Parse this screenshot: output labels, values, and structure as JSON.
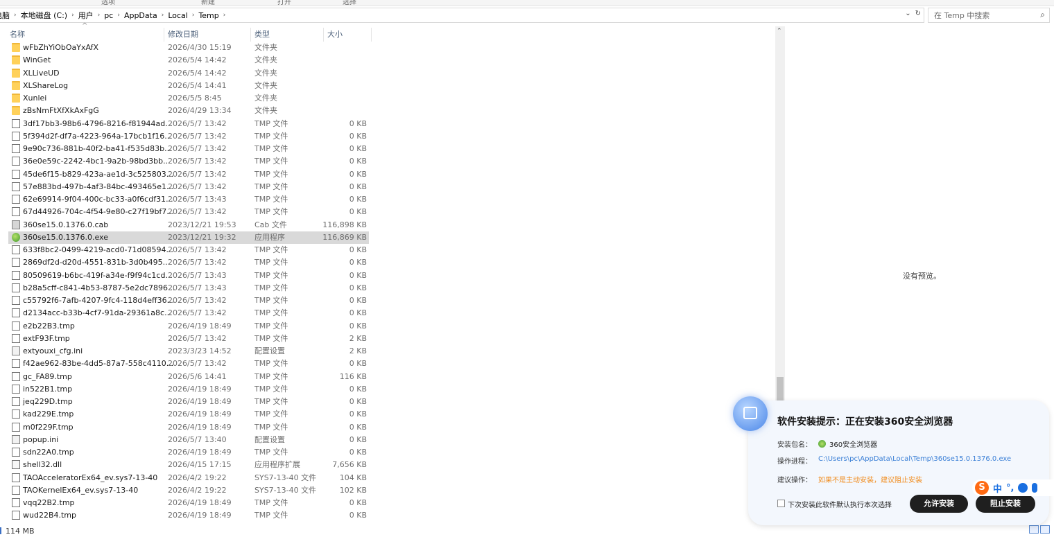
{
  "ribbon_partial": [
    "选项",
    "新建",
    "打开",
    "选择"
  ],
  "breadcrumb": [
    "电脑",
    "本地磁盘 (C:)",
    "用户",
    "pc",
    "AppData",
    "Local",
    "Temp"
  ],
  "search": {
    "placeholder": "在 Temp 中搜索"
  },
  "columns": {
    "name": "名称",
    "modified": "修改日期",
    "type": "类型",
    "size": "大小"
  },
  "files": [
    {
      "name": "wFbZhYiObOaYxAfX",
      "date": "2026/4/30 15:19",
      "type": "文件夹",
      "size": "",
      "icon": "folder"
    },
    {
      "name": "WinGet",
      "date": "2026/5/4 14:42",
      "type": "文件夹",
      "size": "",
      "icon": "folder"
    },
    {
      "name": "XLLiveUD",
      "date": "2026/5/4 14:42",
      "type": "文件夹",
      "size": "",
      "icon": "folder"
    },
    {
      "name": "XLShareLog",
      "date": "2026/5/4 14:41",
      "type": "文件夹",
      "size": "",
      "icon": "folder"
    },
    {
      "name": "Xunlei",
      "date": "2026/5/5 8:45",
      "type": "文件夹",
      "size": "",
      "icon": "folder"
    },
    {
      "name": "zBsNmFtXfXkAxFgG",
      "date": "2026/4/29 13:34",
      "type": "文件夹",
      "size": "",
      "icon": "folder"
    },
    {
      "name": "3df17bb3-98b6-4796-8216-f81944ad...",
      "date": "2026/5/7 13:42",
      "type": "TMP 文件",
      "size": "0 KB",
      "icon": "file"
    },
    {
      "name": "5f394d2f-df7a-4223-964a-17bcb1f16...",
      "date": "2026/5/7 13:42",
      "type": "TMP 文件",
      "size": "0 KB",
      "icon": "file"
    },
    {
      "name": "9e90c736-881b-40f2-ba41-f535d83b...",
      "date": "2026/5/7 13:42",
      "type": "TMP 文件",
      "size": "0 KB",
      "icon": "file"
    },
    {
      "name": "36e0e59c-2242-4bc1-9a2b-98bd3bb...",
      "date": "2026/5/7 13:42",
      "type": "TMP 文件",
      "size": "0 KB",
      "icon": "file"
    },
    {
      "name": "45de6f15-b829-423a-ae1d-3c525803...",
      "date": "2026/5/7 13:42",
      "type": "TMP 文件",
      "size": "0 KB",
      "icon": "file"
    },
    {
      "name": "57e883bd-497b-4af3-84bc-493465e1...",
      "date": "2026/5/7 13:42",
      "type": "TMP 文件",
      "size": "0 KB",
      "icon": "file"
    },
    {
      "name": "62e69914-9f04-400c-bc33-a0f6cdf31...",
      "date": "2026/5/7 13:43",
      "type": "TMP 文件",
      "size": "0 KB",
      "icon": "file"
    },
    {
      "name": "67d44926-704c-4f54-9e80-c27f19bf7...",
      "date": "2026/5/7 13:42",
      "type": "TMP 文件",
      "size": "0 KB",
      "icon": "file"
    },
    {
      "name": "360se15.0.1376.0.cab",
      "date": "2023/12/21 19:53",
      "type": "Cab 文件",
      "size": "116,898 KB",
      "icon": "cab"
    },
    {
      "name": "360se15.0.1376.0.exe",
      "date": "2023/12/21 19:32",
      "type": "应用程序",
      "size": "116,869 KB",
      "icon": "exe",
      "selected": true
    },
    {
      "name": "633f8bc2-0499-4219-acd0-71d08594...",
      "date": "2026/5/7 13:42",
      "type": "TMP 文件",
      "size": "0 KB",
      "icon": "file"
    },
    {
      "name": "2869df2d-d20d-4551-831b-3d0b495...",
      "date": "2026/5/7 13:42",
      "type": "TMP 文件",
      "size": "0 KB",
      "icon": "file"
    },
    {
      "name": "80509619-b6bc-419f-a34e-f9f94c1cd...",
      "date": "2026/5/7 13:43",
      "type": "TMP 文件",
      "size": "0 KB",
      "icon": "file"
    },
    {
      "name": "b28a5cff-c841-4b53-8787-5e2dc7896...",
      "date": "2026/5/7 13:43",
      "type": "TMP 文件",
      "size": "0 KB",
      "icon": "file"
    },
    {
      "name": "c55792f6-7afb-4207-9fc4-118d4eff36...",
      "date": "2026/5/7 13:42",
      "type": "TMP 文件",
      "size": "0 KB",
      "icon": "file"
    },
    {
      "name": "d2134acc-b33b-4cf7-91da-29361a8c...",
      "date": "2026/5/7 13:42",
      "type": "TMP 文件",
      "size": "0 KB",
      "icon": "file"
    },
    {
      "name": "e2b22B3.tmp",
      "date": "2026/4/19 18:49",
      "type": "TMP 文件",
      "size": "0 KB",
      "icon": "file"
    },
    {
      "name": "extF93F.tmp",
      "date": "2026/5/7 13:42",
      "type": "TMP 文件",
      "size": "2 KB",
      "icon": "file"
    },
    {
      "name": "extyouxi_cfg.ini",
      "date": "2023/3/23 14:52",
      "type": "配置设置",
      "size": "2 KB",
      "icon": "ini"
    },
    {
      "name": "f42ae962-83be-4dd5-87a7-558c4110...",
      "date": "2026/5/7 13:42",
      "type": "TMP 文件",
      "size": "0 KB",
      "icon": "file"
    },
    {
      "name": "gc_FA89.tmp",
      "date": "2026/5/6 14:41",
      "type": "TMP 文件",
      "size": "116 KB",
      "icon": "file"
    },
    {
      "name": "in522B1.tmp",
      "date": "2026/4/19 18:49",
      "type": "TMP 文件",
      "size": "0 KB",
      "icon": "file"
    },
    {
      "name": "jeq229D.tmp",
      "date": "2026/4/19 18:49",
      "type": "TMP 文件",
      "size": "0 KB",
      "icon": "file"
    },
    {
      "name": "kad229E.tmp",
      "date": "2026/4/19 18:49",
      "type": "TMP 文件",
      "size": "0 KB",
      "icon": "file"
    },
    {
      "name": "m0f229F.tmp",
      "date": "2026/4/19 18:49",
      "type": "TMP 文件",
      "size": "0 KB",
      "icon": "file"
    },
    {
      "name": "popup.ini",
      "date": "2026/5/7 13:40",
      "type": "配置设置",
      "size": "0 KB",
      "icon": "ini"
    },
    {
      "name": "sdn22A0.tmp",
      "date": "2026/4/19 18:49",
      "type": "TMP 文件",
      "size": "0 KB",
      "icon": "file"
    },
    {
      "name": "shell32.dll",
      "date": "2026/4/15 17:15",
      "type": "应用程序扩展",
      "size": "7,656 KB",
      "icon": "dll"
    },
    {
      "name": "TAOAcceleratorEx64_ev.sys7-13-40",
      "date": "2026/4/2 19:22",
      "type": "SYS7-13-40 文件",
      "size": "104 KB",
      "icon": "file"
    },
    {
      "name": "TAOKernelEx64_ev.sys7-13-40",
      "date": "2026/4/2 19:22",
      "type": "SYS7-13-40 文件",
      "size": "102 KB",
      "icon": "file"
    },
    {
      "name": "vqq22B2.tmp",
      "date": "2026/4/19 18:49",
      "type": "TMP 文件",
      "size": "0 KB",
      "icon": "file"
    },
    {
      "name": "wud22B4.tmp",
      "date": "2026/4/19 18:49",
      "type": "TMP 文件",
      "size": "0 KB",
      "icon": "file"
    }
  ],
  "preview_text": "没有预览。",
  "status": {
    "size": "114 MB"
  },
  "popup": {
    "title": "软件安装提示：正在安装360安全浏览器",
    "pkg_label": "安装包名：",
    "pkg_value": "360安全浏览器",
    "proc_label": "操作进程：",
    "proc_value": "C:\\Users\\pc\\AppData\\Local\\Temp\\360se15.0.1376.0.exe",
    "advice_label": "建议操作：",
    "advice_value": "如果不是主动安装，建议阻止安装",
    "remember_label": "下次安装此软件默认执行本次选择",
    "allow_label": "允许安装",
    "block_label": "阻止安装"
  },
  "ime": {
    "logo": "S",
    "lang": "中",
    "punct": "°,"
  },
  "colors": {
    "accent": "#3a7fd6",
    "warning": "#f08c1e",
    "selected_row": "#d9d9d9",
    "folder": "#ffd15a"
  }
}
